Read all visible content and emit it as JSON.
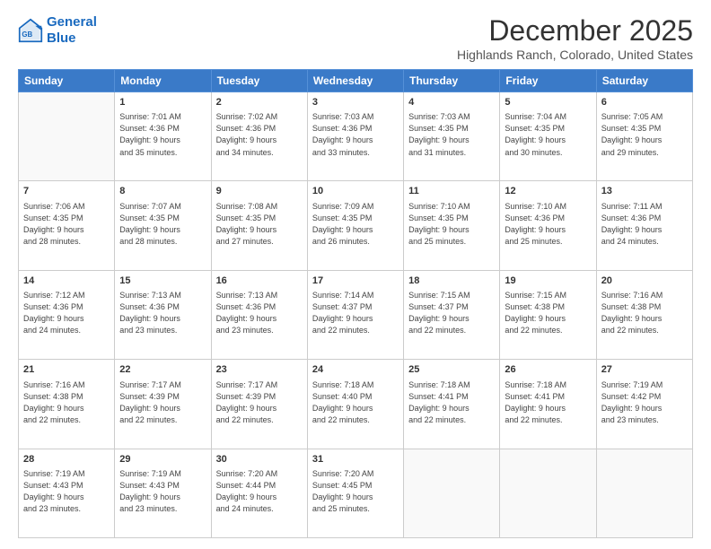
{
  "logo": {
    "line1": "General",
    "line2": "Blue"
  },
  "title": "December 2025",
  "subtitle": "Highlands Ranch, Colorado, United States",
  "days_of_week": [
    "Sunday",
    "Monday",
    "Tuesday",
    "Wednesday",
    "Thursday",
    "Friday",
    "Saturday"
  ],
  "weeks": [
    [
      {
        "num": "",
        "info": ""
      },
      {
        "num": "1",
        "info": "Sunrise: 7:01 AM\nSunset: 4:36 PM\nDaylight: 9 hours\nand 35 minutes."
      },
      {
        "num": "2",
        "info": "Sunrise: 7:02 AM\nSunset: 4:36 PM\nDaylight: 9 hours\nand 34 minutes."
      },
      {
        "num": "3",
        "info": "Sunrise: 7:03 AM\nSunset: 4:36 PM\nDaylight: 9 hours\nand 33 minutes."
      },
      {
        "num": "4",
        "info": "Sunrise: 7:03 AM\nSunset: 4:35 PM\nDaylight: 9 hours\nand 31 minutes."
      },
      {
        "num": "5",
        "info": "Sunrise: 7:04 AM\nSunset: 4:35 PM\nDaylight: 9 hours\nand 30 minutes."
      },
      {
        "num": "6",
        "info": "Sunrise: 7:05 AM\nSunset: 4:35 PM\nDaylight: 9 hours\nand 29 minutes."
      }
    ],
    [
      {
        "num": "7",
        "info": "Sunrise: 7:06 AM\nSunset: 4:35 PM\nDaylight: 9 hours\nand 28 minutes."
      },
      {
        "num": "8",
        "info": "Sunrise: 7:07 AM\nSunset: 4:35 PM\nDaylight: 9 hours\nand 28 minutes."
      },
      {
        "num": "9",
        "info": "Sunrise: 7:08 AM\nSunset: 4:35 PM\nDaylight: 9 hours\nand 27 minutes."
      },
      {
        "num": "10",
        "info": "Sunrise: 7:09 AM\nSunset: 4:35 PM\nDaylight: 9 hours\nand 26 minutes."
      },
      {
        "num": "11",
        "info": "Sunrise: 7:10 AM\nSunset: 4:35 PM\nDaylight: 9 hours\nand 25 minutes."
      },
      {
        "num": "12",
        "info": "Sunrise: 7:10 AM\nSunset: 4:36 PM\nDaylight: 9 hours\nand 25 minutes."
      },
      {
        "num": "13",
        "info": "Sunrise: 7:11 AM\nSunset: 4:36 PM\nDaylight: 9 hours\nand 24 minutes."
      }
    ],
    [
      {
        "num": "14",
        "info": "Sunrise: 7:12 AM\nSunset: 4:36 PM\nDaylight: 9 hours\nand 24 minutes."
      },
      {
        "num": "15",
        "info": "Sunrise: 7:13 AM\nSunset: 4:36 PM\nDaylight: 9 hours\nand 23 minutes."
      },
      {
        "num": "16",
        "info": "Sunrise: 7:13 AM\nSunset: 4:36 PM\nDaylight: 9 hours\nand 23 minutes."
      },
      {
        "num": "17",
        "info": "Sunrise: 7:14 AM\nSunset: 4:37 PM\nDaylight: 9 hours\nand 22 minutes."
      },
      {
        "num": "18",
        "info": "Sunrise: 7:15 AM\nSunset: 4:37 PM\nDaylight: 9 hours\nand 22 minutes."
      },
      {
        "num": "19",
        "info": "Sunrise: 7:15 AM\nSunset: 4:38 PM\nDaylight: 9 hours\nand 22 minutes."
      },
      {
        "num": "20",
        "info": "Sunrise: 7:16 AM\nSunset: 4:38 PM\nDaylight: 9 hours\nand 22 minutes."
      }
    ],
    [
      {
        "num": "21",
        "info": "Sunrise: 7:16 AM\nSunset: 4:38 PM\nDaylight: 9 hours\nand 22 minutes."
      },
      {
        "num": "22",
        "info": "Sunrise: 7:17 AM\nSunset: 4:39 PM\nDaylight: 9 hours\nand 22 minutes."
      },
      {
        "num": "23",
        "info": "Sunrise: 7:17 AM\nSunset: 4:39 PM\nDaylight: 9 hours\nand 22 minutes."
      },
      {
        "num": "24",
        "info": "Sunrise: 7:18 AM\nSunset: 4:40 PM\nDaylight: 9 hours\nand 22 minutes."
      },
      {
        "num": "25",
        "info": "Sunrise: 7:18 AM\nSunset: 4:41 PM\nDaylight: 9 hours\nand 22 minutes."
      },
      {
        "num": "26",
        "info": "Sunrise: 7:18 AM\nSunset: 4:41 PM\nDaylight: 9 hours\nand 22 minutes."
      },
      {
        "num": "27",
        "info": "Sunrise: 7:19 AM\nSunset: 4:42 PM\nDaylight: 9 hours\nand 23 minutes."
      }
    ],
    [
      {
        "num": "28",
        "info": "Sunrise: 7:19 AM\nSunset: 4:43 PM\nDaylight: 9 hours\nand 23 minutes."
      },
      {
        "num": "29",
        "info": "Sunrise: 7:19 AM\nSunset: 4:43 PM\nDaylight: 9 hours\nand 23 minutes."
      },
      {
        "num": "30",
        "info": "Sunrise: 7:20 AM\nSunset: 4:44 PM\nDaylight: 9 hours\nand 24 minutes."
      },
      {
        "num": "31",
        "info": "Sunrise: 7:20 AM\nSunset: 4:45 PM\nDaylight: 9 hours\nand 25 minutes."
      },
      {
        "num": "",
        "info": ""
      },
      {
        "num": "",
        "info": ""
      },
      {
        "num": "",
        "info": ""
      }
    ]
  ]
}
